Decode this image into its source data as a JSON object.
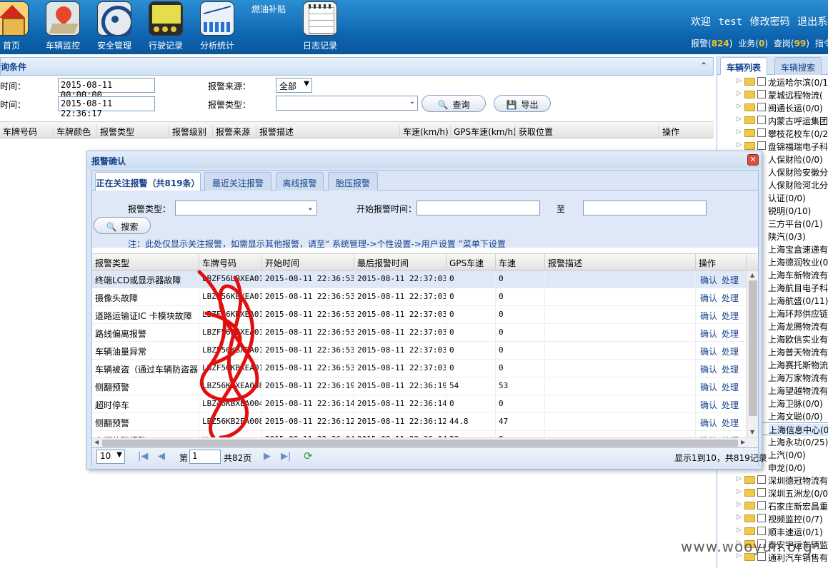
{
  "topnav": {
    "items": [
      {
        "label": "首页",
        "icon": "home-icon"
      },
      {
        "label": "车辆监控",
        "icon": "map-pin-icon"
      },
      {
        "label": "安全管理",
        "icon": "steering-wheel-icon"
      },
      {
        "label": "行驶记录",
        "icon": "recorder-icon"
      },
      {
        "label": "分析统计",
        "icon": "chart-icon"
      },
      {
        "label": "日志记录",
        "icon": "notepad-icon"
      }
    ],
    "fuel_subsidy": "燃油补贴",
    "welcome": "欢迎",
    "username": "test",
    "change_password": "修改密码",
    "logout": "退出系统",
    "counters": [
      {
        "label": "报警",
        "count": "824"
      },
      {
        "label": "业务",
        "count": "0"
      },
      {
        "label": "查岗",
        "count": "99"
      },
      {
        "label": "指令",
        "count": ""
      }
    ]
  },
  "query": {
    "title": "询条件",
    "start_label": "时间：",
    "start_value": "2015-08-11 00:00:00",
    "end_label": "时间：",
    "end_value": "2015-08-11 22:36:17",
    "source_label": "报警来源：",
    "source_value": "全部",
    "type_label": "报警类型：",
    "type_value": "",
    "search_button": "查询",
    "export_button": "导出"
  },
  "main_grid": {
    "columns": [
      "车牌号码",
      "车牌颜色",
      "报警类型",
      "报警级别",
      "报警来源",
      "报警描述",
      "车速(km/h)",
      "GPS车速(km/h)",
      "获取位置",
      "操作"
    ]
  },
  "right_panel": {
    "tabs": [
      "车辆列表",
      "车辆搜索"
    ],
    "tree": [
      {
        "text": "龙运哈尔滨(0/1",
        "folder": true
      },
      {
        "text": "蒙城远程物流(",
        "folder": true
      },
      {
        "text": "闽通长运(0/0)",
        "folder": true
      },
      {
        "text": "内蒙古呼运集团",
        "folder": true
      },
      {
        "text": "攀枝花校车(0/2",
        "folder": true
      },
      {
        "text": "盘锦福瑞电子科",
        "folder": true
      },
      {
        "text": "人保财险(0/0)",
        "folder": false
      },
      {
        "text": "人保财险安徽分",
        "folder": false
      },
      {
        "text": "人保财险河北分",
        "folder": false
      },
      {
        "text": "认证(0/0)",
        "folder": false
      },
      {
        "text": "锐明(0/10)",
        "folder": false
      },
      {
        "text": "三方平台(0/1)",
        "folder": false
      },
      {
        "text": "陕汽(0/3)",
        "folder": false
      },
      {
        "text": "上海宝盒速递有",
        "folder": false
      },
      {
        "text": "上海德润牧业(0",
        "folder": false
      },
      {
        "text": "上海车新物流有",
        "folder": false
      },
      {
        "text": "上海航目电子科",
        "folder": false
      },
      {
        "text": "上海航盛(0/11)",
        "folder": false
      },
      {
        "text": "上海环邦供应链",
        "folder": false
      },
      {
        "text": "上海龙腾物流有",
        "folder": false
      },
      {
        "text": "上海欧信实业有",
        "folder": false
      },
      {
        "text": "上海普天物流有",
        "folder": false
      },
      {
        "text": "上海赛托斯物流",
        "folder": false
      },
      {
        "text": "上海万家物流有",
        "folder": false
      },
      {
        "text": "上海望越物流有",
        "folder": false
      },
      {
        "text": "上海卫脉(0/0)",
        "folder": false
      },
      {
        "text": "上海文聪(0/0)",
        "folder": false
      },
      {
        "text": "上海信息中心(0",
        "folder": false,
        "selected": true
      },
      {
        "text": "上海永功(0/25)",
        "folder": false
      },
      {
        "text": "上汽(0/0)",
        "folder": false
      },
      {
        "text": "申龙(0/0)",
        "folder": false
      },
      {
        "text": "深圳德冠物流有",
        "folder": true
      },
      {
        "text": "深圳五洲龙(0/0",
        "folder": true
      },
      {
        "text": "石家庄新宏昌重",
        "folder": true
      },
      {
        "text": "视频监控(0/7)",
        "folder": true
      },
      {
        "text": "顺丰速运(0/1)",
        "folder": true
      },
      {
        "text": "泰安宇运车辆监",
        "folder": true
      },
      {
        "text": "通利汽车销售有",
        "folder": true
      }
    ]
  },
  "dialog": {
    "title": "报警确认",
    "tabs": [
      "正在关注报警（共819条）",
      "最近关注报警",
      "离线报警",
      "胎压报警"
    ],
    "filter": {
      "type_label": "报警类型：",
      "start_label": "开始报警时间：",
      "to_label": "至",
      "search_button": "搜索",
      "note": "注：此处仅显示关注报警，如需显示其他报警，请至“ 系统管理->个性设置->用户设置 ”菜单下设置"
    },
    "columns": [
      "报警类型",
      "车牌号码",
      "开始时间",
      "最后报警时间",
      "GPS车速",
      "车速",
      "报警描述",
      "操作"
    ],
    "rows": [
      {
        "type": "终端LCD或显示器故障",
        "plate": "LBZF56LBXEA016",
        "start": "2015-08-11 22:36:53",
        "last": "2015-08-11 22:37:03",
        "gps": "0",
        "speed": "0",
        "desc": ""
      },
      {
        "type": "摄像头故障",
        "plate": "LBZF56KBXEA016",
        "start": "2015-08-11 22:36:53",
        "last": "2015-08-11 22:37:03",
        "gps": "0",
        "speed": "0",
        "desc": ""
      },
      {
        "type": "道路运输证IC 卡模块故障",
        "plate": "LBZF56KBXEA016",
        "start": "2015-08-11 22:36:53",
        "last": "2015-08-11 22:37:03",
        "gps": "0",
        "speed": "0",
        "desc": ""
      },
      {
        "type": "路线偏离报警",
        "plate": "LBZF56KBXEA016",
        "start": "2015-08-11 22:36:53",
        "last": "2015-08-11 22:37:03",
        "gps": "0",
        "speed": "0",
        "desc": ""
      },
      {
        "type": "车辆油量异常",
        "plate": "LBZF56KBXEA016",
        "start": "2015-08-11 22:36:53",
        "last": "2015-08-11 22:37:03",
        "gps": "0",
        "speed": "0",
        "desc": ""
      },
      {
        "type": "车辆被盗（通过车辆防盗器",
        "plate": "LBZF56KBXEA016",
        "start": "2015-08-11 22:36:53",
        "last": "2015-08-11 22:37:03",
        "gps": "0",
        "speed": "0",
        "desc": ""
      },
      {
        "type": "侧翻预警",
        "plate": "LBZ56KBXEA008",
        "start": "2015-08-11 22:36:19",
        "last": "2015-08-11 22:36:19",
        "gps": "54",
        "speed": "53",
        "desc": ""
      },
      {
        "type": "超时停车",
        "plate": "LBZ46KBXEA004",
        "start": "2015-08-11 22:36:14",
        "last": "2015-08-11 22:36:14",
        "gps": "0",
        "speed": "0",
        "desc": ""
      },
      {
        "type": "侧翻预警",
        "plate": "LBZ56KB2EA008",
        "start": "2015-08-11 22:36:12",
        "last": "2015-08-11 22:36:12",
        "gps": "44.8",
        "speed": "47",
        "desc": ""
      },
      {
        "type": "车辆故障报警",
        "plate": "沪B0856",
        "start": "2015-08-11 22:36:04",
        "last": "2015-08-11 22:36:04",
        "gps": "23",
        "speed": "0",
        "desc": ""
      }
    ],
    "row_actions": [
      "确认",
      "处理"
    ],
    "pager": {
      "page_size": "10",
      "page_label": "第",
      "page_value": "1",
      "total_pages": "共82页",
      "summary": "显示1到10，共819记录"
    }
  },
  "watermark": "www.wooyun.org"
}
